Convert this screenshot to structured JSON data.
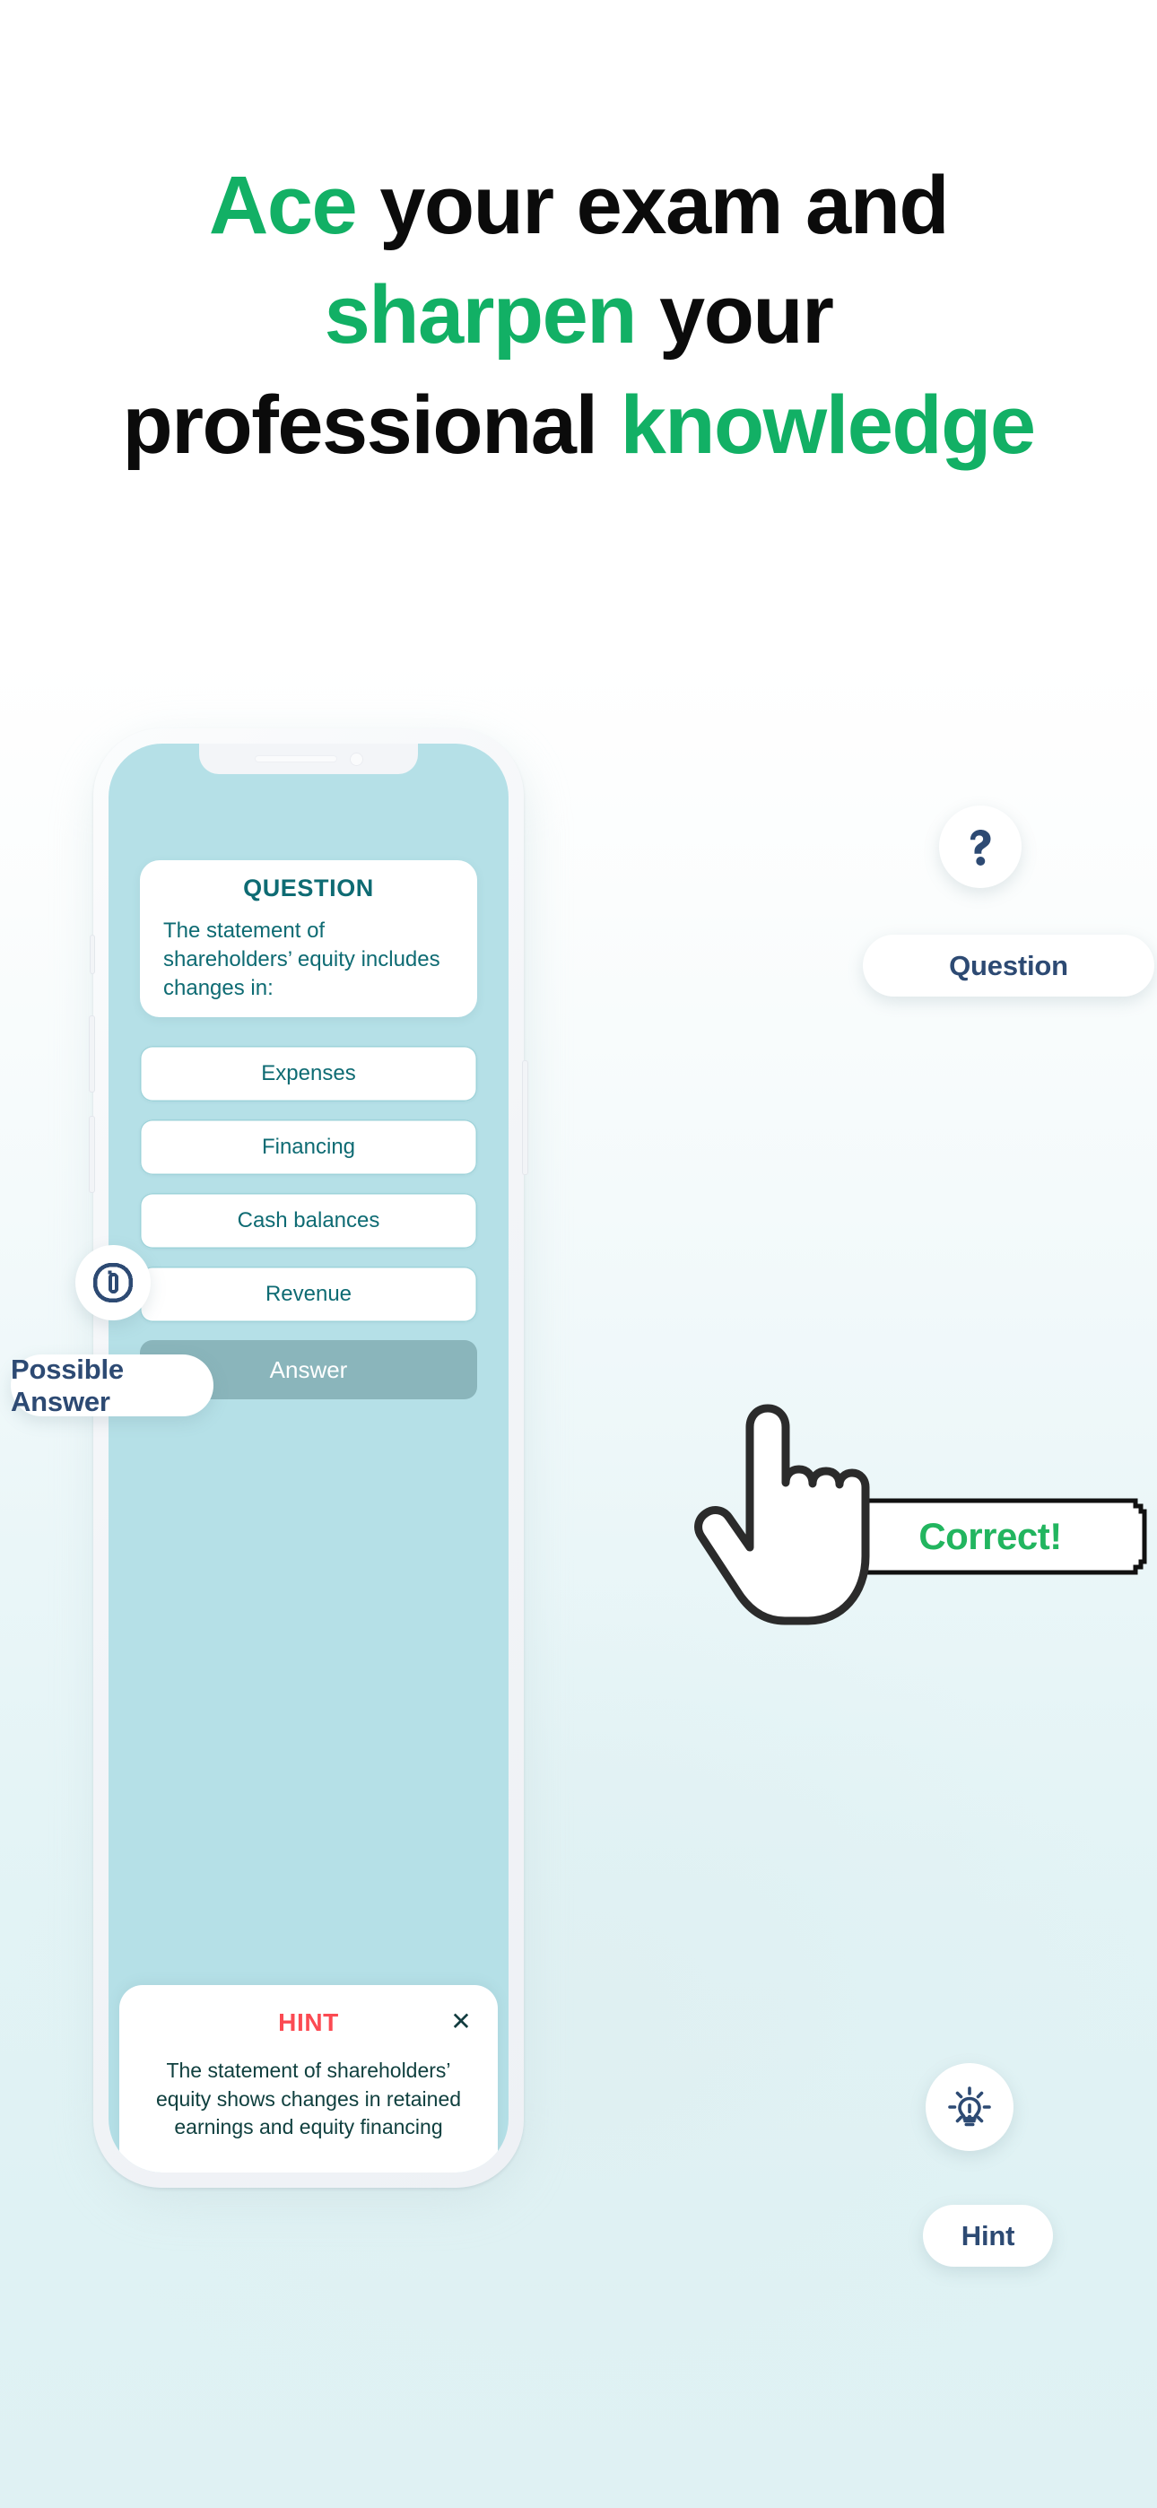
{
  "headline": {
    "line1_green": "Ace",
    "line1_rest": " your exam and",
    "line2_green": "sharpen",
    "line2_rest": " your",
    "line3_rest": "professional ",
    "line3_green": "knowledge"
  },
  "colors": {
    "brand_green": "#12b065",
    "correct_green": "#22b55f",
    "teal_text": "#0e6b73",
    "hint_red": "#fb4a52",
    "navy": "#2d4a73",
    "screen_bg": "#b5e0e7",
    "answer_button": "#8ab5bb"
  },
  "phone": {
    "notch": {
      "speaker_icon": "speaker-slot-icon",
      "camera_icon": "front-camera-icon"
    },
    "question_card": {
      "title": "QUESTION",
      "text": "The statement of shareholders’ equity includes changes in:"
    },
    "options": [
      {
        "label": "Expenses"
      },
      {
        "label": "Financing"
      },
      {
        "label": "Cash balances"
      },
      {
        "label": "Revenue"
      }
    ],
    "answer_button_label": "Answer",
    "hint_card": {
      "title": "HINT",
      "close_icon": "close-icon",
      "text": "The statement of shareholders’ equity shows changes in retained earnings and equity financing"
    }
  },
  "callouts": {
    "question": {
      "icon": "question-mark-icon",
      "label": "Question"
    },
    "possible_answer": {
      "icon": "answer-option-icon",
      "label": "Possible Answer"
    },
    "hint": {
      "icon": "lightbulb-icon",
      "label": "Hint"
    },
    "correct": {
      "label": "Correct!"
    },
    "cursor": {
      "icon": "pointing-hand-cursor-icon"
    }
  }
}
